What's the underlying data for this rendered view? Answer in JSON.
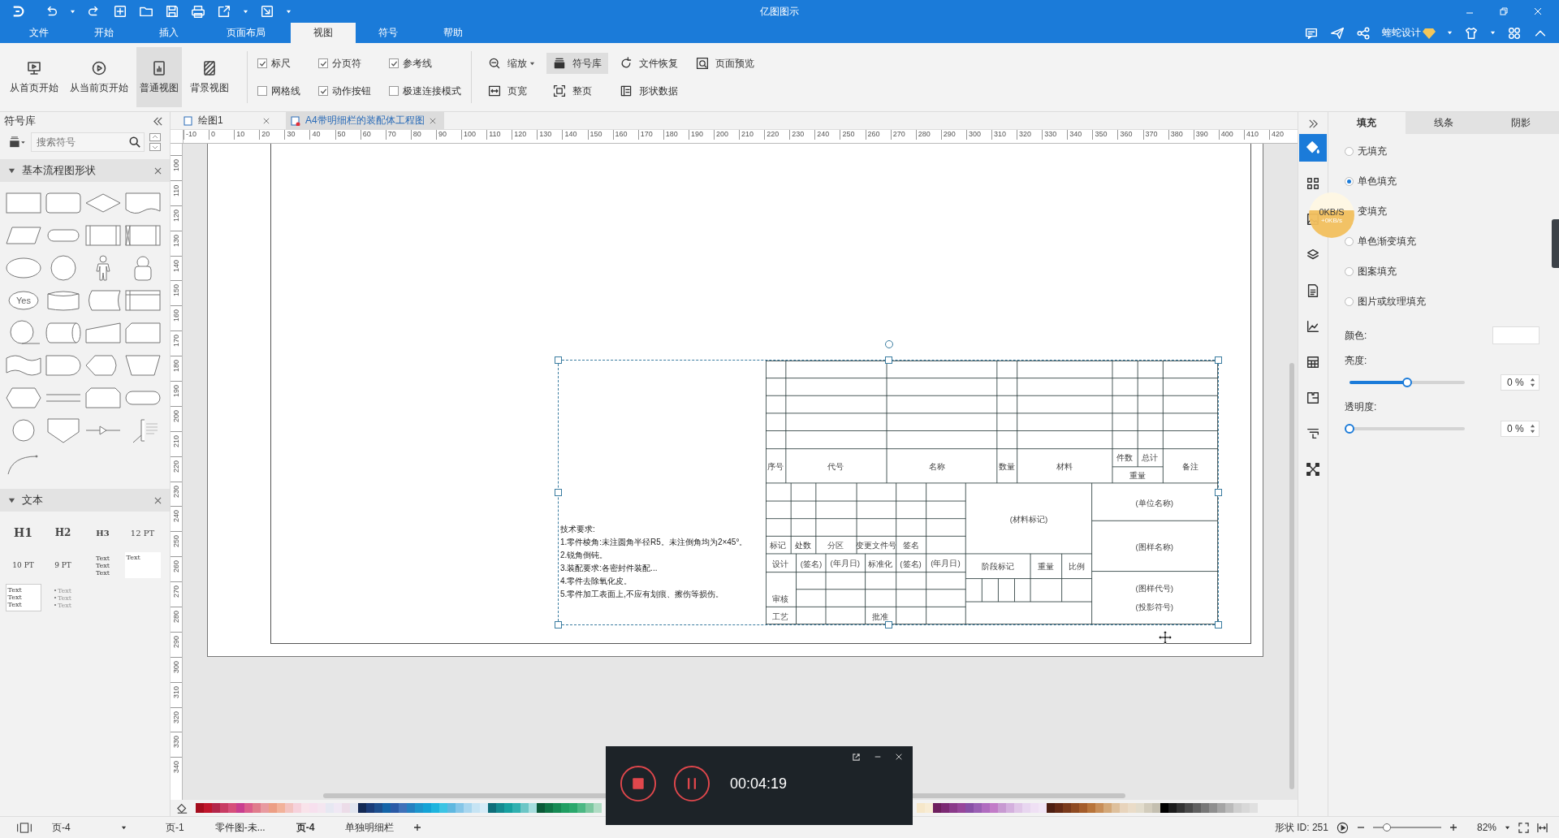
{
  "window": {
    "title": "亿图图示"
  },
  "menu_tabs": [
    {
      "label": "文件",
      "selected": false
    },
    {
      "label": "开始",
      "selected": false
    },
    {
      "label": "插入",
      "selected": false
    },
    {
      "label": "页面布局",
      "selected": false
    },
    {
      "label": "视图",
      "selected": true
    },
    {
      "label": "符号",
      "selected": false
    },
    {
      "label": "帮助",
      "selected": false
    }
  ],
  "account": {
    "user": "蝰蛇设计"
  },
  "ribbon": {
    "large_buttons": [
      {
        "label": "从首页开始",
        "selected": false
      },
      {
        "label": "从当前页开始",
        "selected": false
      },
      {
        "label": "普通视图",
        "selected": true
      },
      {
        "label": "背景视图",
        "selected": false
      }
    ],
    "checkboxes": [
      {
        "label": "标尺",
        "checked": true
      },
      {
        "label": "网格线",
        "checked": false
      },
      {
        "label": "分页符",
        "checked": true
      },
      {
        "label": "动作按钮",
        "checked": true
      },
      {
        "label": "参考线",
        "checked": true
      },
      {
        "label": "极速连接模式",
        "checked": false
      }
    ],
    "tools": [
      {
        "label": "缩放",
        "dropdown": true,
        "selected": false
      },
      {
        "label": "页宽",
        "dropdown": false,
        "selected": false
      },
      {
        "label": "符号库",
        "dropdown": false,
        "selected": true
      },
      {
        "label": "整页",
        "dropdown": false,
        "selected": false
      },
      {
        "label": "文件恢复",
        "dropdown": false,
        "selected": false
      },
      {
        "label": "形状数据",
        "dropdown": false,
        "selected": false
      },
      {
        "label": "页面预览",
        "dropdown": false,
        "selected": false
      }
    ]
  },
  "library": {
    "title": "符号库",
    "search_placeholder": "搜索符号",
    "groups": [
      {
        "title": "基本流程图形状",
        "expanded": true
      },
      {
        "title": "文本",
        "expanded": true
      }
    ],
    "yes_label": "Yes",
    "text_styles": [
      "H1",
      "H2",
      "H3",
      "12 PT",
      "10 PT",
      "9 PT"
    ],
    "text_blocks": [
      {
        "kind": "plain",
        "lines": [
          "Text",
          "Text",
          "Text"
        ]
      },
      {
        "kind": "box",
        "lines": [
          "Text"
        ]
      },
      {
        "kind": "box",
        "lines": [
          "Text",
          "Text",
          "Text"
        ]
      },
      {
        "kind": "bullets",
        "lines": [
          "Text",
          "Text",
          "Text"
        ]
      }
    ]
  },
  "doc_tabs": [
    {
      "label": "绘图1",
      "selected": false
    },
    {
      "label": "A4带明细栏的装配体工程图",
      "selected": true
    }
  ],
  "ruler": {
    "x_labels": [
      "-10",
      "0",
      "10",
      "20",
      "30",
      "40",
      "50",
      "60",
      "70",
      "80",
      "90",
      "100",
      "110",
      "120",
      "130",
      "140",
      "150",
      "160",
      "170",
      "180",
      "190",
      "200",
      "210",
      "220",
      "230",
      "240",
      "250",
      "260",
      "270",
      "280",
      "290",
      "300",
      "310",
      "320",
      "330",
      "340",
      "350",
      "360",
      "370",
      "380",
      "390",
      "400",
      "410",
      "420"
    ],
    "y_labels": [
      "100",
      "110",
      "120",
      "130",
      "140",
      "150",
      "160",
      "170",
      "180",
      "190",
      "200",
      "210",
      "220",
      "230",
      "240",
      "250",
      "260",
      "270",
      "280",
      "290",
      "300",
      "310",
      "320",
      "330",
      "340"
    ]
  },
  "drawing": {
    "notes": [
      "技术要求:",
      "1.零件棱角:未注圆角半径R5。未注倒角均为2×45°。",
      "2.锐角倒钝。",
      "3.装配要求:各密封件装配...",
      "4.零件去除氧化皮。",
      "5.零件加工表面上,不应有划痕、擦伤等损伤。"
    ],
    "title_block": [
      "序号",
      "代号",
      "名称",
      "数量",
      "材料",
      "件数",
      "总计",
      "重量",
      "备注",
      "标记",
      "处数",
      "分区",
      "变更文件号",
      "签名",
      "设计",
      "(签名)",
      "(年月日)",
      "标准化",
      "(签名)",
      "(年月日)",
      "审核",
      "工艺",
      "批准",
      "(材料标记)",
      "阶段标记",
      "重量",
      "比例",
      "(单位名称)",
      "(图样名称)",
      "(图样代号)",
      "(投影符号)"
    ]
  },
  "side_tools": [
    {
      "selected": true
    },
    {
      "selected": false
    },
    {
      "selected": false
    },
    {
      "selected": false
    },
    {
      "selected": false
    },
    {
      "selected": false
    },
    {
      "selected": false
    },
    {
      "selected": false
    },
    {
      "selected": false
    },
    {
      "selected": false
    }
  ],
  "properties": {
    "tabs": [
      {
        "label": "填充",
        "selected": true
      },
      {
        "label": "线条",
        "selected": false
      },
      {
        "label": "阴影",
        "selected": false
      }
    ],
    "fill_options": [
      {
        "label": "无填充",
        "selected": false
      },
      {
        "label": "单色填充",
        "selected": true
      },
      {
        "label": "变填充"
      },
      {
        "label": "单色渐变填充",
        "selected": false
      },
      {
        "label": "图案填充",
        "selected": false
      },
      {
        "label": "图片或纹理填充",
        "selected": false
      }
    ],
    "color_label": "颜色:",
    "brightness": {
      "label": "亮度:",
      "level": 0.5,
      "value": "0 %"
    },
    "transparency": {
      "label": "透明度:",
      "level": 0,
      "value": "0 %"
    }
  },
  "net_speed": {
    "speed": "0KB/S",
    "delta": "+0KB/s"
  },
  "palette": {
    "left": [
      {
        "color": "#a50d1e"
      },
      {
        "color": "#c0162c"
      },
      {
        "color": "#b3264a"
      },
      {
        "color": "#c83c64"
      },
      {
        "color": "#d64f7a"
      },
      {
        "color": "#c93f8f"
      },
      {
        "color": "#db5e8c"
      },
      {
        "color": "#e07c8c"
      },
      {
        "color": "#e89aa0"
      },
      {
        "color": "#ec9e84"
      },
      {
        "color": "#f2b29a"
      },
      {
        "color": "#f3c3c0"
      },
      {
        "color": "#f6d2dc"
      },
      {
        "color": "#f9e3ea"
      },
      {
        "color": "#f7e0ee"
      },
      {
        "color": "#f4e6f0"
      },
      {
        "color": "#e6e8f2"
      },
      {
        "color": "#f0e8f4"
      },
      {
        "color": "#ecdce8"
      },
      {
        "color": "#e2e6f0"
      },
      {
        "color": "#142a55"
      },
      {
        "color": "#1b3c78"
      },
      {
        "color": "#1e4f8e"
      },
      {
        "color": "#1565a8"
      },
      {
        "color": "#2b5aa6"
      },
      {
        "color": "#3f71b9"
      },
      {
        "color": "#2480c0"
      },
      {
        "color": "#1d95cc"
      },
      {
        "color": "#14a3d6"
      },
      {
        "color": "#1eb4de"
      },
      {
        "color": "#3cc4e4"
      },
      {
        "color": "#5fb8e0"
      },
      {
        "color": "#85c6e8"
      },
      {
        "color": "#a8d6ef"
      },
      {
        "color": "#c6e4f4"
      },
      {
        "color": "#d6ecf8"
      },
      {
        "color": "#0e6e7a"
      },
      {
        "color": "#138a90"
      },
      {
        "color": "#17a0a0"
      },
      {
        "color": "#30b0b0"
      },
      {
        "color": "#6cc6c6"
      },
      {
        "color": "#a6dede"
      },
      {
        "color": "#0a5a38"
      },
      {
        "color": "#0f7446"
      },
      {
        "color": "#168a54"
      },
      {
        "color": "#1f9e62"
      },
      {
        "color": "#2aa86c"
      },
      {
        "color": "#4cb884"
      },
      {
        "color": "#7cc8a0"
      },
      {
        "color": "#b0dcc4"
      }
    ],
    "right": [
      {
        "color": "#f6e7c9"
      },
      {
        "color": "#f8ecd4"
      },
      {
        "color": "#6e1f5e"
      },
      {
        "color": "#7c2a74"
      },
      {
        "color": "#8a3a8a"
      },
      {
        "color": "#96469a"
      },
      {
        "color": "#8850a6"
      },
      {
        "color": "#9a60b4"
      },
      {
        "color": "#b06cc0"
      },
      {
        "color": "#c27cc8"
      },
      {
        "color": "#c89ad2"
      },
      {
        "color": "#d4b0de"
      },
      {
        "color": "#e0c6e8"
      },
      {
        "color": "#e8d6f0"
      },
      {
        "color": "#efe0f4"
      },
      {
        "color": "#f2e6f6"
      },
      {
        "color": "#4e1f12"
      },
      {
        "color": "#642a16"
      },
      {
        "color": "#7a3a1c"
      },
      {
        "color": "#8e4a22"
      },
      {
        "color": "#a45c2a"
      },
      {
        "color": "#b8743a"
      },
      {
        "color": "#c88e58"
      },
      {
        "color": "#d4a878"
      },
      {
        "color": "#dec09c"
      },
      {
        "color": "#e8d4bc"
      },
      {
        "color": "#eadcc8"
      },
      {
        "color": "#e2dccc"
      },
      {
        "color": "#d2ccbc"
      },
      {
        "color": "#c4bfb0"
      },
      {
        "color": "#000000"
      },
      {
        "color": "#1c1c1c"
      },
      {
        "color": "#333333"
      },
      {
        "color": "#4a4a4a"
      },
      {
        "color": "#606060"
      },
      {
        "color": "#777777"
      },
      {
        "color": "#8e8e8e"
      },
      {
        "color": "#a4a4a4"
      },
      {
        "color": "#bababa"
      },
      {
        "color": "#cfcfcf"
      },
      {
        "color": "#d8d8d8"
      },
      {
        "color": "#e0e0e0"
      }
    ]
  },
  "status_bar": {
    "page_select": "页-4",
    "pages": [
      {
        "label": "页-1",
        "selected": false
      },
      {
        "label": "零件图-未...",
        "selected": false
      },
      {
        "label": "页-4",
        "selected": true
      },
      {
        "label": "单独明细栏",
        "selected": false
      }
    ],
    "shape_id": "形状 ID: 251",
    "zoom": {
      "level": 0.2,
      "value": "82%"
    }
  },
  "recorder": {
    "time": "00:04:19"
  }
}
